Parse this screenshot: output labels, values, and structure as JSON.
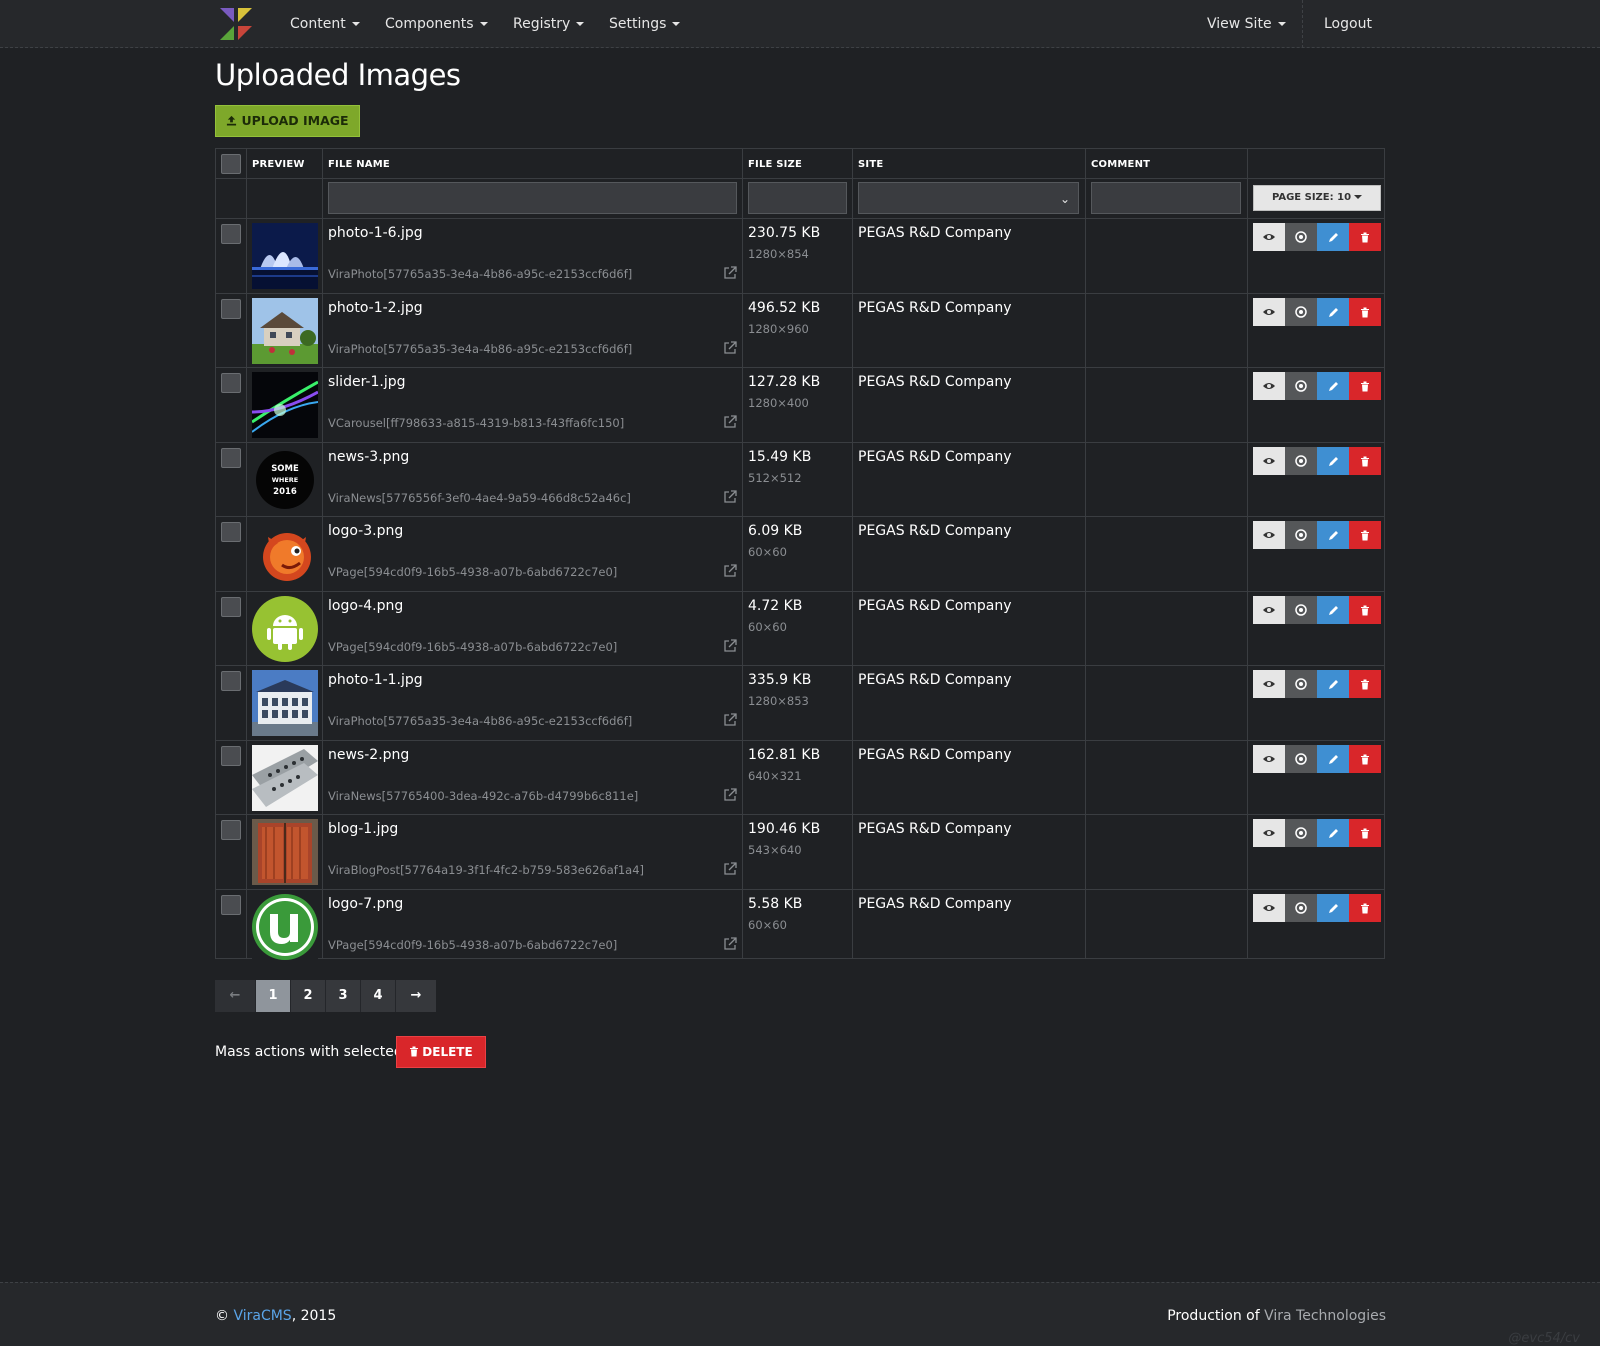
{
  "nav": {
    "items": [
      "Content",
      "Components",
      "Registry",
      "Settings"
    ],
    "view_site": "View Site",
    "logout": "Logout"
  },
  "page": {
    "title": "Uploaded Images",
    "upload_label": "UPLOAD IMAGE"
  },
  "table": {
    "headers": {
      "preview": "PREVIEW",
      "file_name": "FILE NAME",
      "file_size": "FILE SIZE",
      "site": "SITE",
      "comment": "COMMENT"
    },
    "page_size_label": "PAGE SIZE: 10",
    "rows": [
      {
        "name": "photo-1-6.jpg",
        "ref": "ViraPhoto[57765a35-3e4a-4b86-a95c-e2153ccf6d6f]",
        "size": "230.75 KB",
        "dims": "1280×854",
        "site": "PEGAS R&D Company",
        "comment": ""
      },
      {
        "name": "photo-1-2.jpg",
        "ref": "ViraPhoto[57765a35-3e4a-4b86-a95c-e2153ccf6d6f]",
        "size": "496.52 KB",
        "dims": "1280×960",
        "site": "PEGAS R&D Company",
        "comment": ""
      },
      {
        "name": "slider-1.jpg",
        "ref": "VCarousel[ff798633-a815-4319-b813-f43ffa6fc150]",
        "size": "127.28 KB",
        "dims": "1280×400",
        "site": "PEGAS R&D Company",
        "comment": ""
      },
      {
        "name": "news-3.png",
        "ref": "ViraNews[5776556f-3ef0-4ae4-9a59-466d8c52a46c]",
        "size": "15.49 KB",
        "dims": "512×512",
        "site": "PEGAS R&D Company",
        "comment": ""
      },
      {
        "name": "logo-3.png",
        "ref": "VPage[594cd0f9-16b5-4938-a07b-6abd6722c7e0]",
        "size": "6.09 KB",
        "dims": "60×60",
        "site": "PEGAS R&D Company",
        "comment": ""
      },
      {
        "name": "logo-4.png",
        "ref": "VPage[594cd0f9-16b5-4938-a07b-6abd6722c7e0]",
        "size": "4.72 KB",
        "dims": "60×60",
        "site": "PEGAS R&D Company",
        "comment": ""
      },
      {
        "name": "photo-1-1.jpg",
        "ref": "ViraPhoto[57765a35-3e4a-4b86-a95c-e2153ccf6d6f]",
        "size": "335.9 KB",
        "dims": "1280×853",
        "site": "PEGAS R&D Company",
        "comment": ""
      },
      {
        "name": "news-2.png",
        "ref": "ViraNews[57765400-3dea-492c-a76b-d4799b6c811e]",
        "size": "162.81 KB",
        "dims": "640×321",
        "site": "PEGAS R&D Company",
        "comment": ""
      },
      {
        "name": "blog-1.jpg",
        "ref": "ViraBlogPost[57764a19-3f1f-4fc2-b759-583e626af1a4]",
        "size": "190.46 KB",
        "dims": "543×640",
        "site": "PEGAS R&D Company",
        "comment": ""
      },
      {
        "name": "logo-7.png",
        "ref": "VPage[594cd0f9-16b5-4938-a07b-6abd6722c7e0]",
        "size": "5.58 KB",
        "dims": "60×60",
        "site": "PEGAS R&D Company",
        "comment": ""
      }
    ],
    "news3_badge": [
      "SOME",
      "WHERE",
      "2016"
    ]
  },
  "pagination": {
    "prev": "←",
    "pages": [
      "1",
      "2",
      "3",
      "4"
    ],
    "active": "1",
    "next": "→"
  },
  "mass_actions": {
    "label": "Mass actions with selected:",
    "delete_label": "DELETE"
  },
  "footer": {
    "copyright_symbol": "©",
    "brand": "ViraCMS",
    "year": ", 2015",
    "production_prefix": "Production of",
    "company": "Vira Technologies",
    "watermark": "@evc54/cv"
  },
  "colors": {
    "accent": "#7ea82a",
    "danger": "#d9262a",
    "primary": "#3f8fd2",
    "link": "#5aa4e8"
  }
}
